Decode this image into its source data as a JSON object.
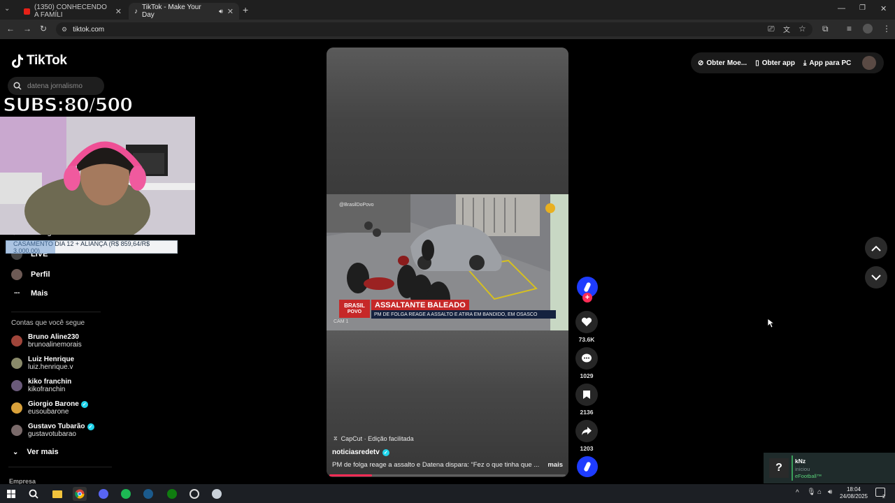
{
  "browser": {
    "tabs": [
      {
        "label": "(1350) CONHECENDO A FAMÍLI",
        "active": false
      },
      {
        "label": "TikTok - Make Your Day",
        "active": true
      }
    ],
    "url": "tiktok.com"
  },
  "tiktok": {
    "logo": "TikTok",
    "search_placeholder": "datena jornalismo",
    "nav": [
      {
        "label": "LIVE",
        "icon": "live-icon"
      },
      {
        "label": "Perfil",
        "icon": "avatar"
      },
      {
        "label": "Mais",
        "icon": "more-icon"
      }
    ],
    "partial_nav_text": "Mensagens",
    "following_title": "Contas que você segue",
    "following": [
      {
        "name": "Bruno Aline230",
        "handle": "brunoalinemorais",
        "verified": false,
        "color": "#a0453a"
      },
      {
        "name": "Luiz Henrique",
        "handle": "luiz.henrique.v",
        "verified": false,
        "color": "#8a8a6a"
      },
      {
        "name": "kiko franchin",
        "handle": "kikofranchin",
        "verified": false,
        "color": "#6a5a7a"
      },
      {
        "name": "Giorgio Barone",
        "handle": "eusoubarone",
        "verified": true,
        "color": "#d9a13a"
      },
      {
        "name": "Gustavo Tubarão",
        "handle": "gustavotubarao",
        "verified": true,
        "color": "#7a6a6a"
      }
    ],
    "see_more": "Ver mais",
    "footer_company": "Empresa",
    "top_right": {
      "coins": "Obter Moe...",
      "get_app": "Obter app",
      "pc_app": "App para PC"
    }
  },
  "overlay": {
    "subs": "SUBS:80/500",
    "goal_text": "CASAMENTO DIA 12 + ALIANÇA (R$ 859,64/R$ 3.000,00)",
    "goal_fraction": 0.29
  },
  "video": {
    "channel_tag": "@BrasilDoPovo",
    "headline_brand_1": "BRASIL",
    "headline_brand_2": "POVO",
    "headline_title": "ASSALTANTE BALEADO",
    "headline_sub": "PM DE FOLGA REAGE A ASSALTO E ATIRA EM BANDIDO, EM OSASCO",
    "cam_label": "CAM 1",
    "capcut": "CapCut · Edição facilitada",
    "author": "noticiasredetv",
    "caption": "PM de folga reage a assalto e Datena dispara: “Fez o que tinha que ...",
    "more": "mais",
    "likes": "73.6K",
    "comments": "1029",
    "saves": "2136",
    "shares": "1203",
    "progress_fraction": 0.18
  },
  "notification": {
    "user": "kNz",
    "action": "iniciou",
    "game": "eFootball™"
  },
  "taskbar": {
    "time": "18:04",
    "date": "24/08/2025",
    "notif_count": "2"
  },
  "colors": {
    "accent": "#fe2c55",
    "verified": "#20d5ec"
  }
}
